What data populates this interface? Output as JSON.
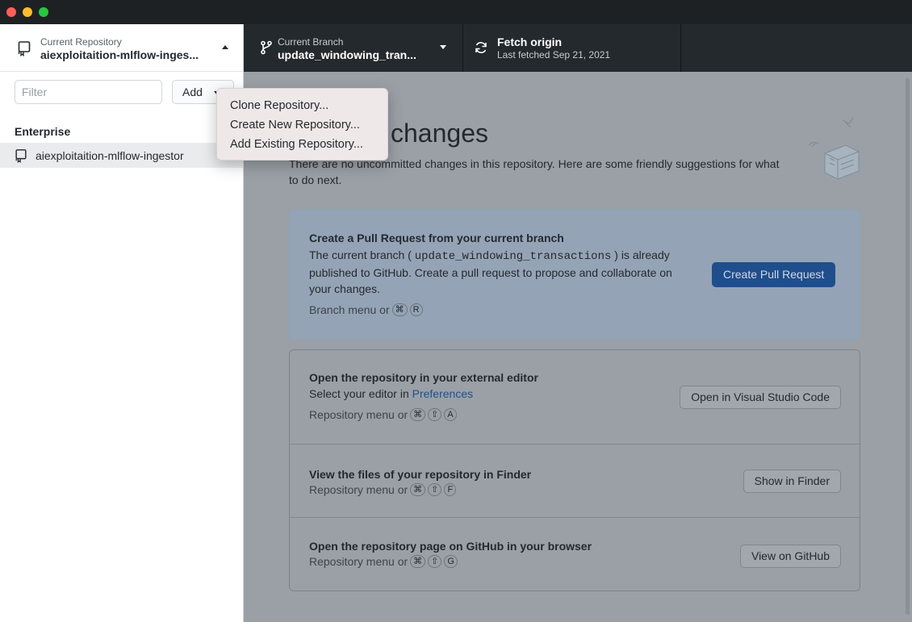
{
  "window": {
    "traffic_lights": [
      "close",
      "minimize",
      "zoom"
    ]
  },
  "toolbar": {
    "repository": {
      "label": "Current Repository",
      "value": "aiexploitaition-mlflow-inges..."
    },
    "branch": {
      "label": "Current Branch",
      "value": "update_windowing_tran..."
    },
    "fetch": {
      "label": "Fetch origin",
      "status": "Last fetched Sep 21, 2021"
    }
  },
  "sidebar": {
    "filter_placeholder": "Filter",
    "add_label": "Add",
    "group_header": "Enterprise",
    "repositories": [
      {
        "name": "aiexploitaition-mlflow-ingestor"
      }
    ]
  },
  "add_menu": {
    "items": [
      "Clone Repository...",
      "Create New Repository...",
      "Add Existing Repository..."
    ]
  },
  "main": {
    "heading": "No local changes",
    "heading_visible": "l changes",
    "intro": "There are no uncommitted changes in this repository. Here are some friendly suggestions for what to do next.",
    "pull_request": {
      "title": "Create a Pull Request from your current branch",
      "text_before": "The current branch (",
      "branch_name": "update_windowing_transactions",
      "text_after": ") is already published to GitHub. Create a pull request to propose and collaborate on your changes.",
      "hint": "Branch menu or",
      "keys": [
        "⌘",
        "R"
      ],
      "button": "Create Pull Request"
    },
    "editor": {
      "title": "Open the repository in your external editor",
      "text": "Select your editor in",
      "link": "Preferences",
      "hint": "Repository menu or",
      "keys": [
        "⌘",
        "⇧",
        "A"
      ],
      "button": "Open in Visual Studio Code"
    },
    "finder": {
      "title": "View the files of your repository in Finder",
      "hint": "Repository menu or",
      "keys": [
        "⌘",
        "⇧",
        "F"
      ],
      "button": "Show in Finder"
    },
    "github": {
      "title": "Open the repository page on GitHub in your browser",
      "hint": "Repository menu or",
      "keys": [
        "⌘",
        "⇧",
        "G"
      ],
      "button": "View on GitHub"
    }
  },
  "colors": {
    "toolbar_dark": "#24292e",
    "primary_button": "#1f4e8c",
    "accent_link": "#1f4f8f",
    "menu_background": "#efe8e8"
  }
}
